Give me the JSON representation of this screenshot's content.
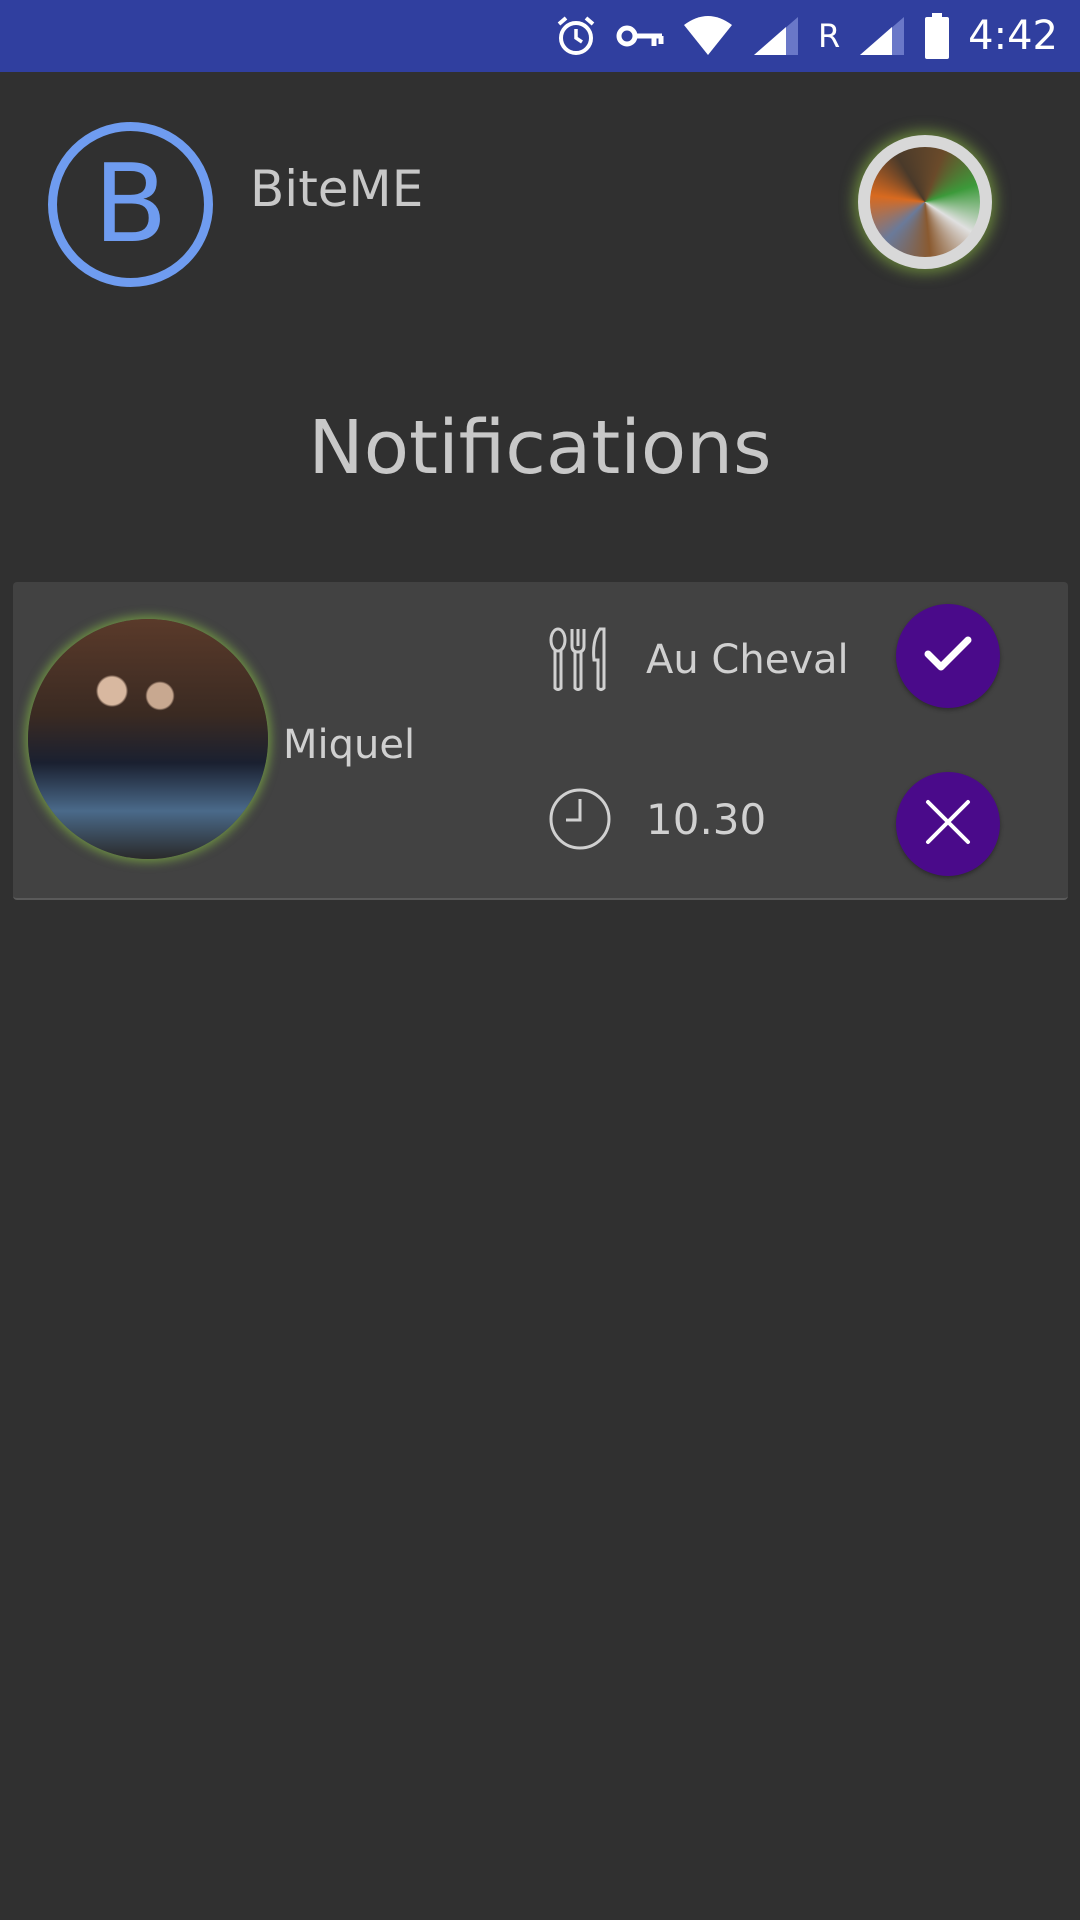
{
  "status_bar": {
    "time": "4:42",
    "network_label": "R",
    "icons": [
      "alarm-icon",
      "vpn-key-icon",
      "wifi-icon",
      "signal-icon",
      "signal-icon",
      "battery-icon"
    ]
  },
  "app": {
    "logo_letter": "B",
    "title": "BiteME",
    "accent_color": "#6f9cf0"
  },
  "page": {
    "title": "Notifications"
  },
  "notifications": [
    {
      "friend_name": "Miquel",
      "restaurant": "Au Cheval",
      "time": "10.30",
      "restaurant_icon": "utensils-icon",
      "time_icon": "clock-icon",
      "accept_icon": "check-icon",
      "decline_icon": "close-icon",
      "button_color": "#4a0a8a"
    }
  ]
}
